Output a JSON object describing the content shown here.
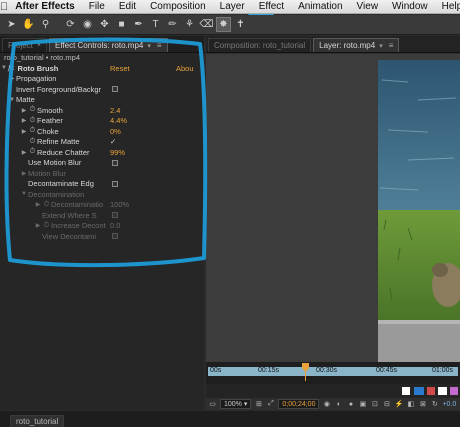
{
  "menubar": {
    "items": [
      "After Effects",
      "File",
      "Edit",
      "Composition",
      "Layer",
      "Effect",
      "Animation",
      "View",
      "Window",
      "Help"
    ]
  },
  "toolbar": {
    "tools": [
      "selection-tool",
      "hand-tool",
      "zoom-tool",
      "rotate-tool",
      "camera-tool",
      "pan-behind-tool",
      "rectangle-tool",
      "pen-tool",
      "text-tool",
      "brush-tool",
      "clone-stamp-tool",
      "eraser-tool",
      "roto-brush-tool",
      "puppet-pin-tool"
    ],
    "active_tool": "roto-brush-tool"
  },
  "left_panel": {
    "tabs": {
      "project": "Project",
      "effect_controls": "Effect Controls: roto.mp4"
    },
    "breadcrumb": "roto_tutorial • roto.mp4",
    "effect": {
      "name": "Roto Brush",
      "reset": "Reset",
      "about": "Abou"
    },
    "properties": [
      {
        "label": "Propagation",
        "type": "group",
        "level": 1,
        "dim": false
      },
      {
        "label": "Invert Foreground/Backgr",
        "type": "checkbox",
        "level": 1,
        "dim": false
      },
      {
        "label": "Matte",
        "type": "group-open",
        "level": 1,
        "dim": false
      },
      {
        "label": "Smooth",
        "value": "2.4",
        "type": "value",
        "level": 2,
        "dim": false
      },
      {
        "label": "Feather",
        "value": "4.4%",
        "type": "value",
        "level": 2,
        "dim": false
      },
      {
        "label": "Choke",
        "value": "0%",
        "type": "value",
        "level": 2,
        "dim": false
      },
      {
        "label": "Refine Matte",
        "value": "✓",
        "type": "check",
        "level": 2,
        "dim": false
      },
      {
        "label": "Reduce Chatter",
        "value": "99%",
        "type": "value",
        "level": 2,
        "dim": false
      },
      {
        "label": "Use Motion Blur",
        "type": "checkbox",
        "level": 2,
        "dim": false
      },
      {
        "label": "Motion Blur",
        "type": "group",
        "level": 2,
        "dim": true
      },
      {
        "label": "Decontaminate Edg",
        "type": "checkbox",
        "level": 2,
        "dim": false
      },
      {
        "label": "Decontamination",
        "type": "group-open",
        "level": 2,
        "dim": true
      },
      {
        "label": "Decontaminatio",
        "value": "100%",
        "type": "value",
        "level": 3,
        "dim": true
      },
      {
        "label": "Extend Where S",
        "type": "checkbox",
        "level": 3,
        "dim": true
      },
      {
        "label": "Increase Decont",
        "value": "0.0",
        "type": "value",
        "level": 3,
        "dim": true
      },
      {
        "label": "View Decontami",
        "type": "checkbox",
        "level": 3,
        "dim": true
      }
    ]
  },
  "right_panel": {
    "tabs": {
      "composition": "Composition: roto_tutorial",
      "layer": "Layer: roto.mp4"
    },
    "timeline": {
      "ticks": [
        "00s",
        "00:15s",
        "00:30s",
        "00:45s",
        "01:00s"
      ],
      "playhead_fraction": 0.39
    },
    "footer": {
      "zoom": "100%",
      "timecode": "0;00;24;00",
      "exposure": "+0.0"
    }
  },
  "bottom": {
    "tab": "roto_tutorial"
  },
  "colors": {
    "accent_value": "#e9a23b",
    "annotation": "#1e9ad6",
    "menu_underline": "#2aa3e0"
  }
}
